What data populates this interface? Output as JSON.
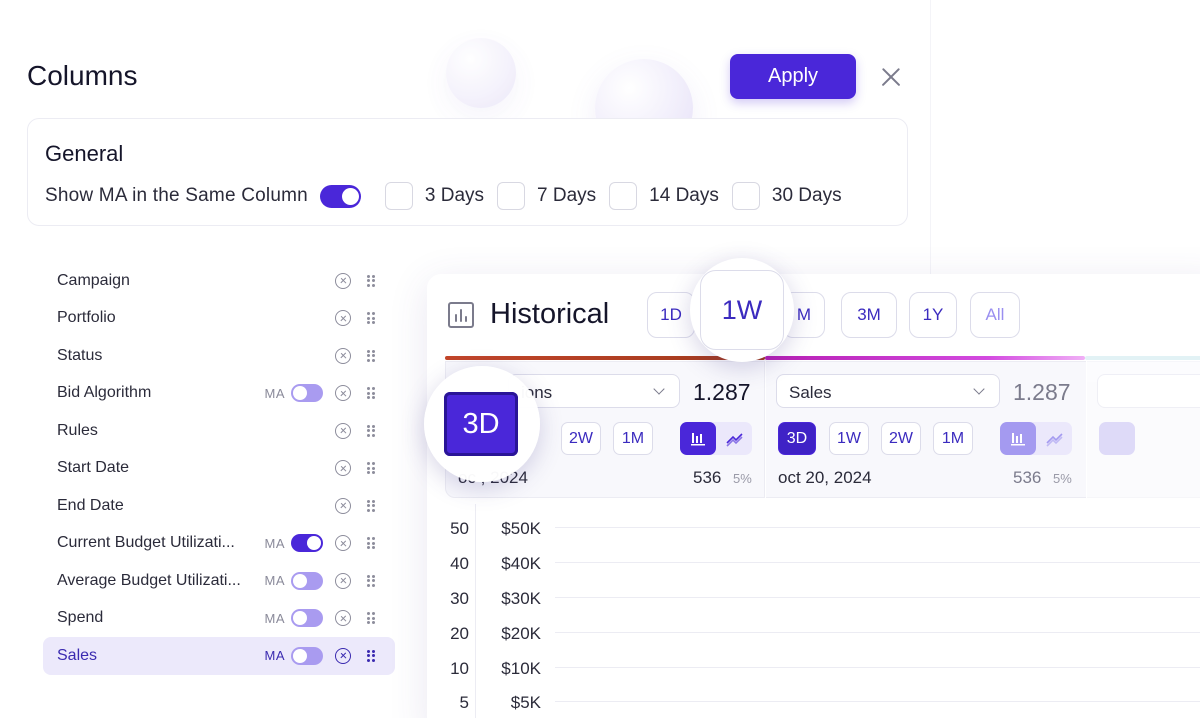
{
  "header": {
    "title": "Columns",
    "apply_label": "Apply"
  },
  "general": {
    "title": "General",
    "show_ma_label": "Show MA in the Same Column",
    "show_ma_enabled": true,
    "day_options": [
      {
        "label": "3 Days",
        "checked": false
      },
      {
        "label": "7 Days",
        "checked": false
      },
      {
        "label": "14 Days",
        "checked": false
      },
      {
        "label": "30 Days",
        "checked": false
      }
    ]
  },
  "columns": [
    {
      "label": "Campaign"
    },
    {
      "label": "Portfolio"
    },
    {
      "label": "Status"
    },
    {
      "label": "Bid Algorithm",
      "ma": "MA",
      "ma_on": false
    },
    {
      "label": "Rules"
    },
    {
      "label": "Start Date"
    },
    {
      "label": "End Date"
    },
    {
      "label": "Current Budget Utilizati...",
      "ma": "MA",
      "ma_on": true
    },
    {
      "label": "Average Budget Utilizati...",
      "ma": "MA",
      "ma_on": false
    },
    {
      "label": "Spend",
      "ma": "MA",
      "ma_on": false
    },
    {
      "label": "Sales",
      "ma": "MA",
      "ma_on": false,
      "selected": true
    }
  ],
  "historical": {
    "title": "Historical",
    "ranges": [
      "1D",
      "1W",
      "M",
      "3M",
      "1Y",
      "All"
    ],
    "magnified_range": "1W",
    "magnified_metric_range": "3D",
    "metric1": {
      "select": "ions",
      "value": "1.287",
      "ranges": [
        "2W",
        "1M"
      ],
      "date": "oc    , 2024",
      "count": "536",
      "pct": "5%"
    },
    "metric2": {
      "select": "Sales",
      "value": "1.287",
      "ranges": [
        "3D",
        "1W",
        "2W",
        "1M"
      ],
      "date": "oct 20, 2024",
      "count": "536",
      "pct": "5%"
    },
    "y_axis_left": [
      "50",
      "40",
      "30",
      "20",
      "10",
      "5"
    ],
    "y_axis_right": [
      "$50K",
      "$40K",
      "$30K",
      "$20K",
      "$10K",
      "$5K"
    ]
  },
  "colors": {
    "accent": "#4a27d9",
    "accent_soft": "#a99bf0",
    "selected_row": "#ece9fb",
    "metric1_bar": "#b23f22",
    "metric2_bar": "#c22fc6"
  }
}
